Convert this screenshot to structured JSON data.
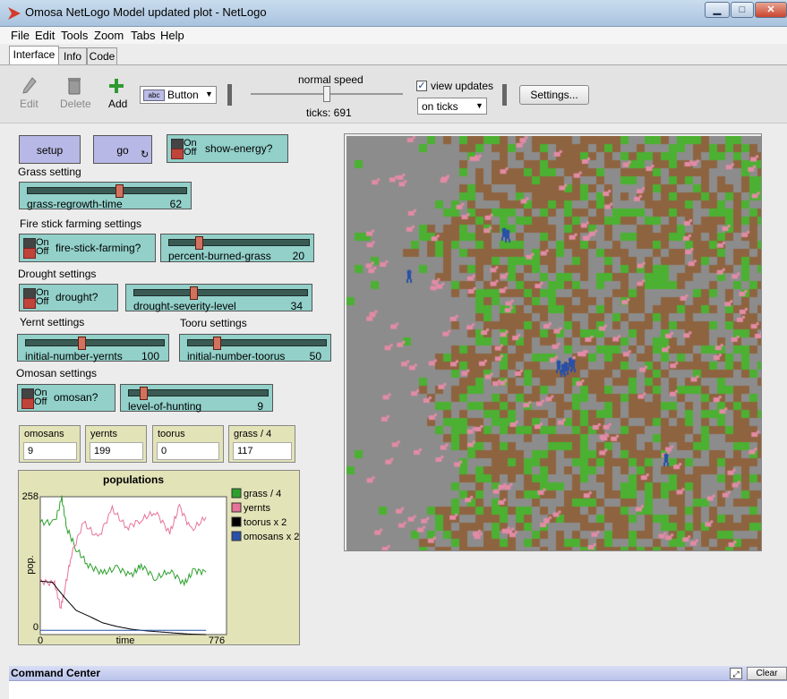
{
  "window": {
    "title": "Omosa NetLogo Model updated plot - NetLogo",
    "minimize": "▁",
    "maximize": "□",
    "close": "✕"
  },
  "menu": [
    "File",
    "Edit",
    "Tools",
    "Zoom",
    "Tabs",
    "Help"
  ],
  "tabs": [
    "Interface",
    "Info",
    "Code"
  ],
  "toolbar": {
    "edit_label": "Edit",
    "delete_label": "Delete",
    "add_label": "Add",
    "widget_type": "Button",
    "widget_type_icon": "abc",
    "speed_label": "normal speed",
    "ticks_label": "ticks: 691",
    "view_updates_label": "view updates",
    "update_mode": "on ticks",
    "settings_label": "Settings..."
  },
  "buttons": {
    "setup": "setup",
    "go": "go"
  },
  "switch_text": {
    "on": "On",
    "off": "Off"
  },
  "switches": {
    "show_energy": "show-energy?",
    "fire_stick": "fire-stick-farming?",
    "drought": "drought?",
    "omosan": "omosan?"
  },
  "sections": {
    "grass": "Grass setting",
    "fire": "Fire stick farming settings",
    "drought": "Drought settings",
    "yernt": "Yernt settings",
    "toorus": "Tooru settings",
    "omosan": "Omosan settings"
  },
  "sliders": {
    "grass_regrowth": {
      "name": "grass-regrowth-time",
      "value": "62",
      "fraction": 0.58
    },
    "percent_burned": {
      "name": "percent-burned-grass",
      "value": "20",
      "fraction": 0.2
    },
    "drought_severity": {
      "name": "drought-severity-level",
      "value": "34",
      "fraction": 0.34
    },
    "initial_yernts": {
      "name": "initial-number-yernts",
      "value": "100",
      "fraction": 0.4
    },
    "initial_toorus": {
      "name": "initial-number-toorus",
      "value": "50",
      "fraction": 0.2
    },
    "hunting": {
      "name": "level-of-hunting",
      "value": "9",
      "fraction": 0.09
    }
  },
  "monitors": [
    {
      "name": "omosans",
      "value": "9"
    },
    {
      "name": "yernts",
      "value": "199"
    },
    {
      "name": "toorus",
      "value": "0"
    },
    {
      "name": "grass / 4",
      "value": "117"
    }
  ],
  "colors": {
    "grass": "#4cb032",
    "soil": "#8e6440",
    "gray": "#8c8c8c",
    "yernt": "#e38ba6",
    "tooru": "#000000",
    "omosan": "#2850a8"
  },
  "chart_data": {
    "type": "line",
    "title": "populations",
    "xlabel": "time",
    "ylabel": "pop.",
    "xlim": [
      0,
      776
    ],
    "ylim": [
      0,
      258
    ],
    "x_tick_labels": [
      "0",
      "776"
    ],
    "y_tick_labels": [
      "0",
      "258"
    ],
    "legend_position": "right",
    "series": [
      {
        "name": "grass / 4",
        "color": "#2ca02c",
        "x": [
          0,
          60,
          90,
          110,
          150,
          200,
          260,
          320,
          380,
          420,
          480,
          540,
          600,
          640,
          691
        ],
        "y": [
          210,
          210,
          255,
          200,
          160,
          130,
          115,
          125,
          110,
          130,
          105,
          120,
          95,
          120,
          117
        ]
      },
      {
        "name": "yernts",
        "color": "#e67399",
        "x": [
          0,
          60,
          85,
          100,
          130,
          180,
          240,
          300,
          360,
          420,
          480,
          540,
          580,
          630,
          691
        ],
        "y": [
          100,
          95,
          50,
          80,
          150,
          210,
          180,
          235,
          200,
          215,
          230,
          190,
          240,
          195,
          220
        ]
      },
      {
        "name": "toorus x 2",
        "color": "#000000",
        "x": [
          0,
          50,
          100,
          150,
          200,
          260,
          320,
          380,
          440,
          500,
          560,
          620,
          691
        ],
        "y": [
          100,
          98,
          70,
          45,
          35,
          22,
          15,
          10,
          7,
          5,
          3,
          1,
          0
        ]
      },
      {
        "name": "omosans x 2",
        "color": "#2850a8",
        "x": [
          0,
          691
        ],
        "y": [
          8,
          8
        ]
      }
    ]
  }
}
